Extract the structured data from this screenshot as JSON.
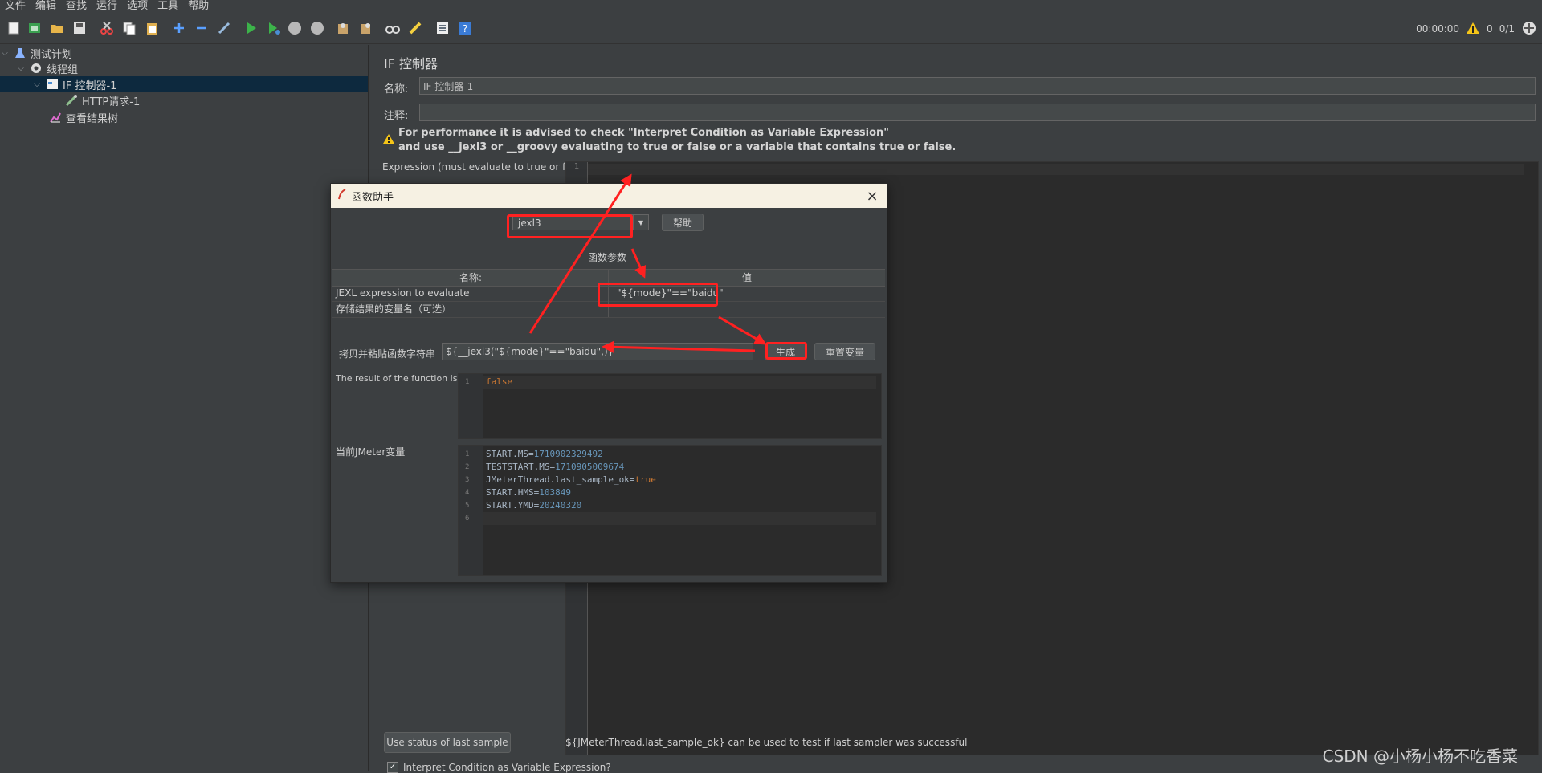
{
  "menubar": {
    "items": [
      "文件",
      "编辑",
      "查找",
      "运行",
      "选项",
      "工具",
      "帮助"
    ]
  },
  "toolbar": {
    "icons": [
      "new-icon",
      "templates-icon",
      "open-icon",
      "save-icon",
      "cut-icon",
      "copy-icon",
      "paste-icon",
      "expand-icon",
      "collapse-icon",
      "toggle-icon",
      "start-icon",
      "start-no-pause-icon",
      "stop-icon",
      "shutdown-icon",
      "clear-icon",
      "clear-all-icon",
      "search-icon",
      "reset-search-icon",
      "function-helper-icon",
      "help-icon"
    ],
    "timer": "00:00:00",
    "warnings": "0",
    "threads": "0/1"
  },
  "tree": {
    "items": [
      {
        "label": "测试计划",
        "icon": "flask-icon"
      },
      {
        "label": "线程组",
        "icon": "gear-icon"
      },
      {
        "label": "IF 控制器-1",
        "icon": "if-controller-icon"
      },
      {
        "label": "HTTP请求-1",
        "icon": "pipette-icon"
      },
      {
        "label": "查看结果树",
        "icon": "chart-icon"
      }
    ]
  },
  "panel": {
    "title": "IF 控制器",
    "name_label": "名称:",
    "name_value": "IF 控制器-1",
    "comment_label": "注释:",
    "comment_value": "",
    "warning_line1": "For performance it is advised to check \"Interpret Condition as Variable Expression\"",
    "warning_line2": "and use __jexl3 or __groovy evaluating to true or false or a variable that contains true or false.",
    "expression_label": "Expression (must evaluate to true or false)",
    "editor_line": "1",
    "use_status_button": "Use status of last sample",
    "status_hint": "${JMeterThread.last_sample_ok} can be used to test if last sampler was successful",
    "interpret_checkbox": "Interpret Condition as Variable Expression?"
  },
  "dialog": {
    "title": "函数助手",
    "function_selected": "jexl3",
    "help_button": "帮助",
    "params_title": "函数参数",
    "col_name": "名称:",
    "col_value": "值",
    "rows": [
      {
        "name": "JEXL expression to evaluate",
        "value": "\"${mode}\"==\"baidu\""
      },
      {
        "name": "存储结果的变量名（可选）",
        "value": ""
      }
    ],
    "copy_label": "拷贝并粘贴函数字符串",
    "copy_value": "${__jexl3(\"${mode}\"==\"baidu\",)}",
    "generate_button": "生成",
    "reset_button": "重置变量",
    "result_label": "The result of the function is",
    "result_value": "false",
    "vars_label": "当前JMeter变量",
    "vars": [
      {
        "key": "START.MS=",
        "val": "1710902329492"
      },
      {
        "key": "TESTSTART.MS=",
        "val": "1710905009674"
      },
      {
        "key": "JMeterThread.last_sample_ok=",
        "val": "true"
      },
      {
        "key": "START.HMS=",
        "val": "103849"
      },
      {
        "key": "START.YMD=",
        "val": "20240320"
      }
    ]
  },
  "watermark": "CSDN @小杨小杨不吃香菜",
  "colors": {
    "accent_red": "#ff2121",
    "selection": "#0d293e"
  }
}
